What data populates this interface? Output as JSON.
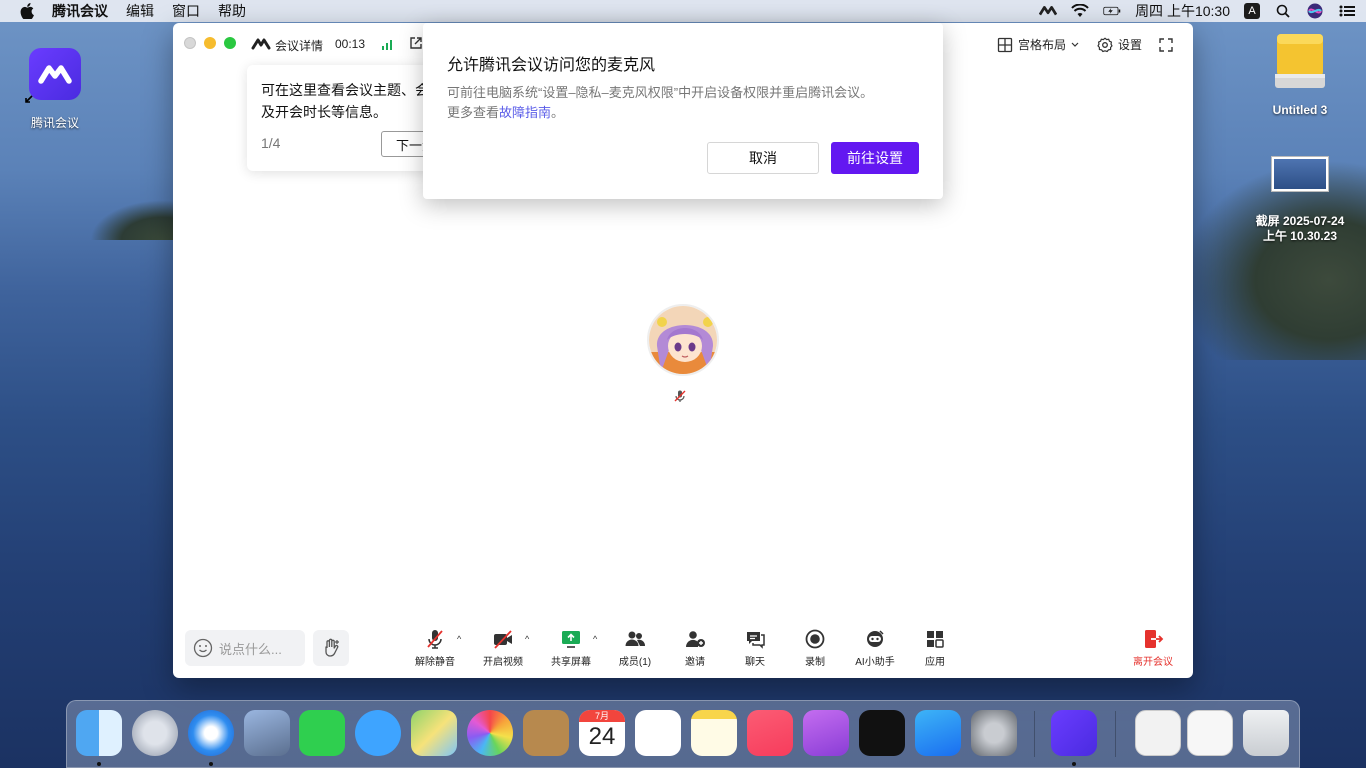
{
  "menubar": {
    "app_name": "腾讯会议",
    "items": [
      "编辑",
      "窗口",
      "帮助"
    ],
    "clock": "周四 上午10:30",
    "input_badge": "A"
  },
  "desktop": {
    "tencent_label": "腾讯会议",
    "drive_label": "Untitled 3",
    "screenshot_label_line1": "截屏 2025-07-24",
    "screenshot_label_line2": "上午 10.30.23"
  },
  "meeting": {
    "details_label": "会议详情",
    "timer": "00:13",
    "layout_label": "宫格布局",
    "settings_label": "设置"
  },
  "tip": {
    "text": "可在这里查看会议主题、会议号及开会时长等信息。",
    "step": "1/4",
    "next_label": "下一步"
  },
  "dialog": {
    "title": "允许腾讯会议访问您的麦克风",
    "body_line1": "可前往电脑系统“设置–隐私–麦克风权限”中开启设备权限并重启腾讯会议。",
    "body_prefix": "更多查看",
    "guide_link": "故障指南",
    "body_suffix": "。",
    "cancel_label": "取消",
    "confirm_label": "前往设置"
  },
  "toolbar": {
    "chat_placeholder": "说点什么...",
    "unmute_label": "解除静音",
    "video_label": "开启视频",
    "share_label": "共享屏幕",
    "members_label": "成员(1)",
    "invite_label": "邀请",
    "chat_label": "聊天",
    "record_label": "录制",
    "ai_label": "AI小助手",
    "apps_label": "应用",
    "leave_label": "离开会议"
  },
  "dock": {
    "calendar_month": "7月",
    "calendar_day": "24"
  },
  "colors": {
    "accent": "#6318f1",
    "link": "#5a5ce8",
    "leave": "#e5322d",
    "share_green": "#1aab55"
  }
}
